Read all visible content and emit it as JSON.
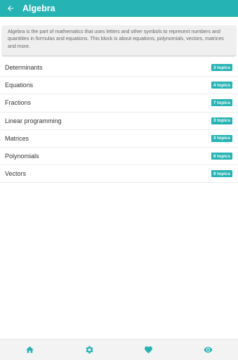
{
  "app_bar": {
    "title": "Algebra",
    "back_icon": "arrow-left-icon",
    "background": "#26b3b3"
  },
  "intro": {
    "text": "Algebra is the part of mathematics that uses letters and other symbols to represent numbers and quantities in formulas and equations. This block is about equations, polynomials, vectors, matrices and more."
  },
  "topics": [
    {
      "label": "Determinants",
      "badge": "3 topics"
    },
    {
      "label": "Equations",
      "badge": "4 topics"
    },
    {
      "label": "Fractions",
      "badge": "7 topics"
    },
    {
      "label": "Linear programming",
      "badge": "3 topics"
    },
    {
      "label": "Matrices",
      "badge": "3 topics"
    },
    {
      "label": "Polynomials",
      "badge": "8 topics"
    },
    {
      "label": "Vectors",
      "badge": "9 topics"
    }
  ],
  "bottom_nav": {
    "items": [
      "home-icon",
      "gear-icon",
      "heart-icon",
      "eye-icon"
    ],
    "icon_color": "#26b3b3"
  }
}
